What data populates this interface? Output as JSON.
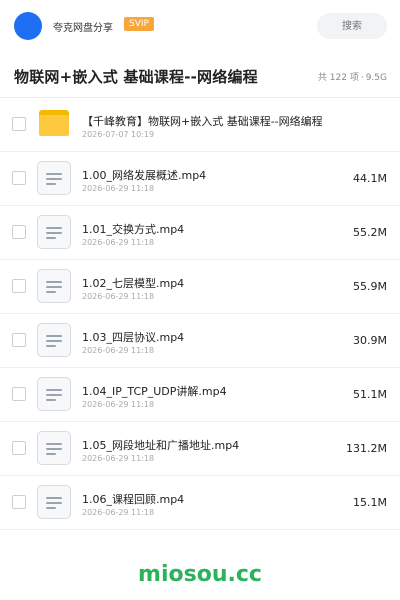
{
  "header": {
    "share_name": "夸克网盘分享",
    "badge": "SVIP",
    "search_placeholder": "搜索"
  },
  "folder_info": {
    "title": "物联网+嵌入式 基础课程--网络编程",
    "count": "共 122 项",
    "separator": "·",
    "size": "9.5G"
  },
  "files": [
    {
      "icon": "folder-icon",
      "name": "【千峰教育】物联网+嵌入式 基础课程--网络编程",
      "date": "2026-07-07 10:19",
      "size": ""
    },
    {
      "icon": "video-file-icon",
      "name": "1.00_网络发展概述.mp4",
      "date": "2026-06-29 11:18",
      "size": "44.1M"
    },
    {
      "icon": "video-file-icon",
      "name": "1.01_交换方式.mp4",
      "date": "2026-06-29 11:18",
      "size": "55.2M"
    },
    {
      "icon": "video-file-icon",
      "name": "1.02_七层模型.mp4",
      "date": "2026-06-29 11:18",
      "size": "55.9M"
    },
    {
      "icon": "video-file-icon",
      "name": "1.03_四层协议.mp4",
      "date": "2026-06-29 11:18",
      "size": "30.9M"
    },
    {
      "icon": "video-file-icon",
      "name": "1.04_IP_TCP_UDP讲解.mp4",
      "date": "2026-06-29 11:18",
      "size": "51.1M"
    },
    {
      "icon": "video-file-icon",
      "name": "1.05_网段地址和广播地址.mp4",
      "date": "2026-06-29 11:18",
      "size": "131.2M"
    },
    {
      "icon": "video-file-icon",
      "name": "1.06_课程回顾.mp4",
      "date": "2026-06-29 11:18",
      "size": "15.1M"
    }
  ],
  "watermark": "miosou.cc",
  "colors": {
    "avatar": "#1f6ff2",
    "svip_badge": "#f8a53a",
    "folder": "#ffc93d",
    "watermark": "#2bb25b"
  }
}
